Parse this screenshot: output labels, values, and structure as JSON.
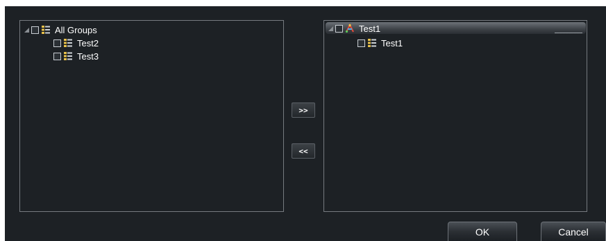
{
  "available_tree": {
    "root_label": "All Groups",
    "children": [
      {
        "label": "Test2"
      },
      {
        "label": "Test3"
      }
    ]
  },
  "selected_tree": {
    "root_label": "Test1",
    "children": [
      {
        "label": "Test1"
      }
    ]
  },
  "transfer": {
    "add_label": ">>",
    "remove_label": "<<"
  },
  "actions": {
    "ok_label": "OK",
    "cancel_label": "Cancel"
  },
  "icons": {
    "group": "group-tree-icon",
    "device": "device-icon"
  },
  "colors": {
    "background": "#1d2125",
    "panel_border": "#767b80",
    "text": "#ffffff"
  }
}
